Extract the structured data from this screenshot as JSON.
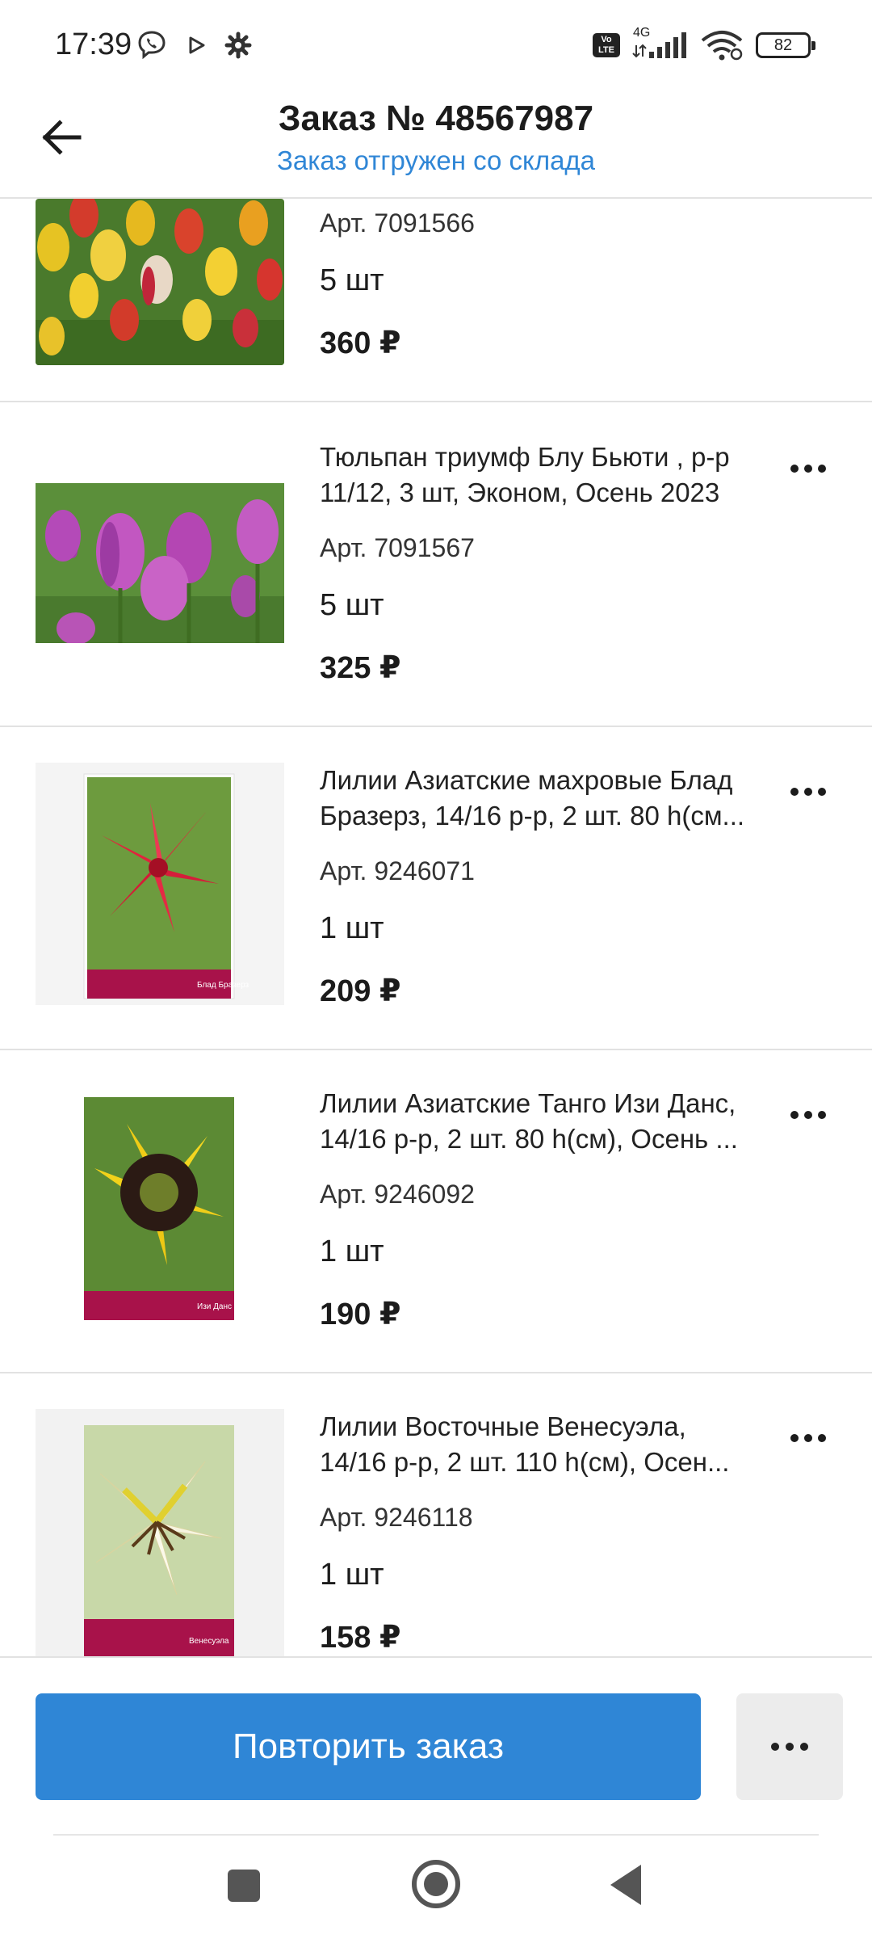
{
  "status_bar": {
    "time": "17:39",
    "network": "4G",
    "battery": "82"
  },
  "header": {
    "title": "Заказ № 48567987",
    "subtitle": "Заказ отгружен со склада"
  },
  "items": [
    {
      "name_lines": [],
      "article": "Арт. 7091566",
      "quantity": "5 шт",
      "price": "360 ₽",
      "thumb": "tulips-mixed"
    },
    {
      "name_lines": [
        "Тюльпан триумф Блу Бьюти , р-р",
        "11/12, 3 шт, Эконом, Осень 2023"
      ],
      "article": "Арт. 7091567",
      "quantity": "5 шт",
      "price": "325 ₽",
      "thumb": "tulips-purple"
    },
    {
      "name_lines": [
        "Лилии Азиатские махровые Блад",
        "Бразерз, 14/16 р-р, 2 шт. 80 h(см..."
      ],
      "article": "Арт. 9246071",
      "quantity": "1 шт",
      "price": "209 ₽",
      "thumb": "lily-red"
    },
    {
      "name_lines": [
        "Лилии Азиатские Танго Изи Данс,",
        "14/16 р-р, 2 шт. 80 h(см), Осень ..."
      ],
      "article": "Арт. 9246092",
      "quantity": "1 шт",
      "price": "190 ₽",
      "thumb": "lily-yellow-black"
    },
    {
      "name_lines": [
        "Лилии Восточные Венесуэла,",
        "14/16 р-р, 2 шт. 110 h(см), Осен..."
      ],
      "article": "Арт. 9246118",
      "quantity": "1 шт",
      "price": "158 ₽",
      "thumb": "lily-white"
    }
  ],
  "bottom": {
    "repeat_label": "Повторить заказ"
  },
  "colors": {
    "accent": "#2f86d6",
    "divider": "#e2e2e2"
  }
}
